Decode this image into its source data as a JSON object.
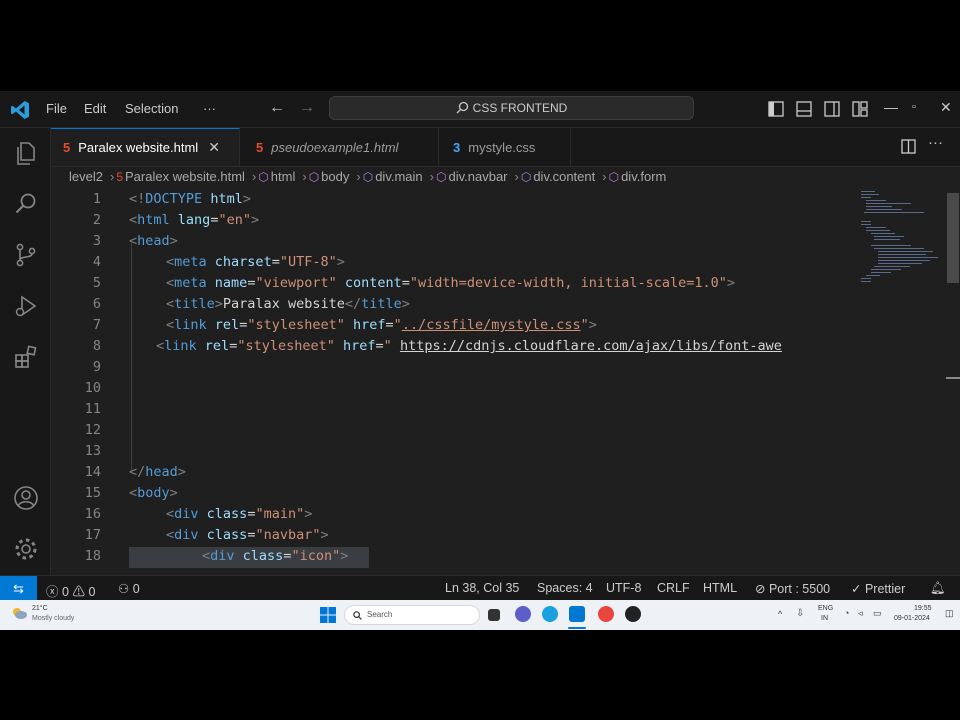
{
  "menu": {
    "file": "File",
    "edit": "Edit",
    "selection": "Selection",
    "more": "···"
  },
  "command_center": "CSS FRONTEND",
  "tabs": [
    {
      "label": "Paralex website.html",
      "icon": "html-file-icon",
      "active": true
    },
    {
      "label": "pseudoexample1.html",
      "icon": "html-file-icon",
      "active": false
    },
    {
      "label": "mystyle.css",
      "icon": "css-file-icon",
      "active": false
    }
  ],
  "breadcrumb": [
    "level2",
    "Paralex website.html",
    "html",
    "body",
    "div.main",
    "div.navbar",
    "div.content",
    "div.form"
  ],
  "code": {
    "line_numbers": [
      "1",
      "2",
      "3",
      "4",
      "5",
      "6",
      "7",
      "8",
      "9",
      "10",
      "11",
      "12",
      "13",
      "14",
      "15",
      "16",
      "17",
      "18"
    ],
    "l1": {
      "open": "<!",
      "tag": "DOCTYPE",
      "space": " ",
      "attr": "html",
      "close": ">"
    },
    "l2": {
      "open": "<",
      "tag": "html",
      "space": " ",
      "attr": "lang",
      "eq": "=",
      "val": "\"en\"",
      "close": ">"
    },
    "l3": {
      "open": "<",
      "tag": "head",
      "close": ">"
    },
    "l4": {
      "open": "<",
      "tag": "meta",
      "space": " ",
      "attr": "charset",
      "eq": "=",
      "val": "\"UTF-8\"",
      "close": ">"
    },
    "l5": {
      "open": "<",
      "tag": "meta",
      "a1": "name",
      "v1": "\"viewport\"",
      "a2": "content",
      "v2": "\"width=device-width, initial-scale=1.0\"",
      "close": ">"
    },
    "l6": {
      "open": "<",
      "tag": "title",
      "text": "Paralax website",
      "endopen": "</",
      "endtag": "title",
      "close": ">"
    },
    "l7": {
      "open": "<",
      "tag": "link",
      "a1": "rel",
      "v1": "\"stylesheet\"",
      "a2": "href",
      "q": "\"",
      "v2": "../cssfile/mystyle.css",
      "q2": "\"",
      "close": ">"
    },
    "l8": {
      "open": "<",
      "tag": "link",
      "a1": "rel",
      "v1": "\"stylesheet\"",
      "a2": "href",
      "q": "\" ",
      "v2": "https://cdnjs.cloudflare.com/ajax/libs/font-awe"
    },
    "l14": {
      "open": "</",
      "tag": "head",
      "close": ">"
    },
    "l15": {
      "open": "<",
      "tag": "body",
      "close": ">"
    },
    "l16": {
      "open": "<",
      "tag": "div",
      "a1": "class",
      "v1": "\"main\"",
      "close": ">"
    },
    "l17": {
      "open": "<",
      "tag": "div",
      "a1": "class",
      "v1": "\"navbar\"",
      "close": ">"
    },
    "l18": {
      "open": "<",
      "tag": "div",
      "a1": "class",
      "v1": "\"icon\"",
      "close": ">"
    }
  },
  "status": {
    "remote": "⇆",
    "errors": "0",
    "warnings": "0",
    "ports": "0",
    "position": "Ln 38, Col 35",
    "spaces": "Spaces: 4",
    "encoding": "UTF-8",
    "eol": "CRLF",
    "language": "HTML",
    "port": "Port : 5500",
    "prettier": "Prettier"
  },
  "taskbar": {
    "weather_temp": "21°C",
    "weather_desc": "Mostly cloudy",
    "search_placeholder": "Search",
    "lang": "ENG",
    "region": "IN",
    "time": "19:55",
    "date": "09-01-2024"
  },
  "colors": {
    "accent": "#0078d4",
    "tag": "#569cd6",
    "attr": "#9cdcfe",
    "string": "#ce9178"
  }
}
